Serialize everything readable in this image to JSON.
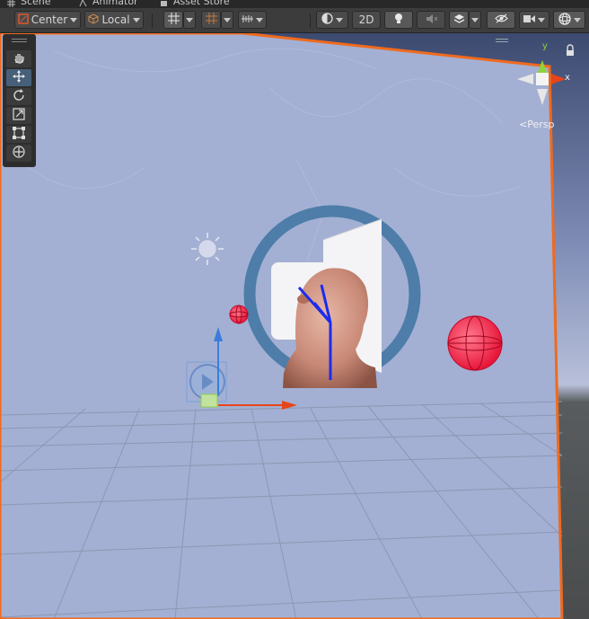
{
  "tabs": [
    {
      "label": "Scene",
      "icon": "grid-icon"
    },
    {
      "label": "Animator",
      "icon": "animator-icon"
    },
    {
      "label": "Asset Store",
      "icon": "store-icon"
    }
  ],
  "toolbar": {
    "pivot_label": "Center",
    "space_label": "Local",
    "mode_2d_label": "2D"
  },
  "gizmo": {
    "x_axis_label": "x",
    "y_axis_label": "y",
    "projection_label": "Persp"
  },
  "tools": [
    "hand-tool-icon",
    "move-tool-icon",
    "rotate-tool-icon",
    "scale-tool-icon",
    "rect-tool-icon",
    "transform-tool-icon"
  ],
  "colors": {
    "selection_outline": "#f06a1e",
    "scene_bg": "#a3b0d3",
    "x_axis": "#e8441a",
    "y_axis": "#8ed33a",
    "z_axis": "#3c7ddb",
    "bone": "#1b2cf0",
    "collider": "#f0284a"
  }
}
